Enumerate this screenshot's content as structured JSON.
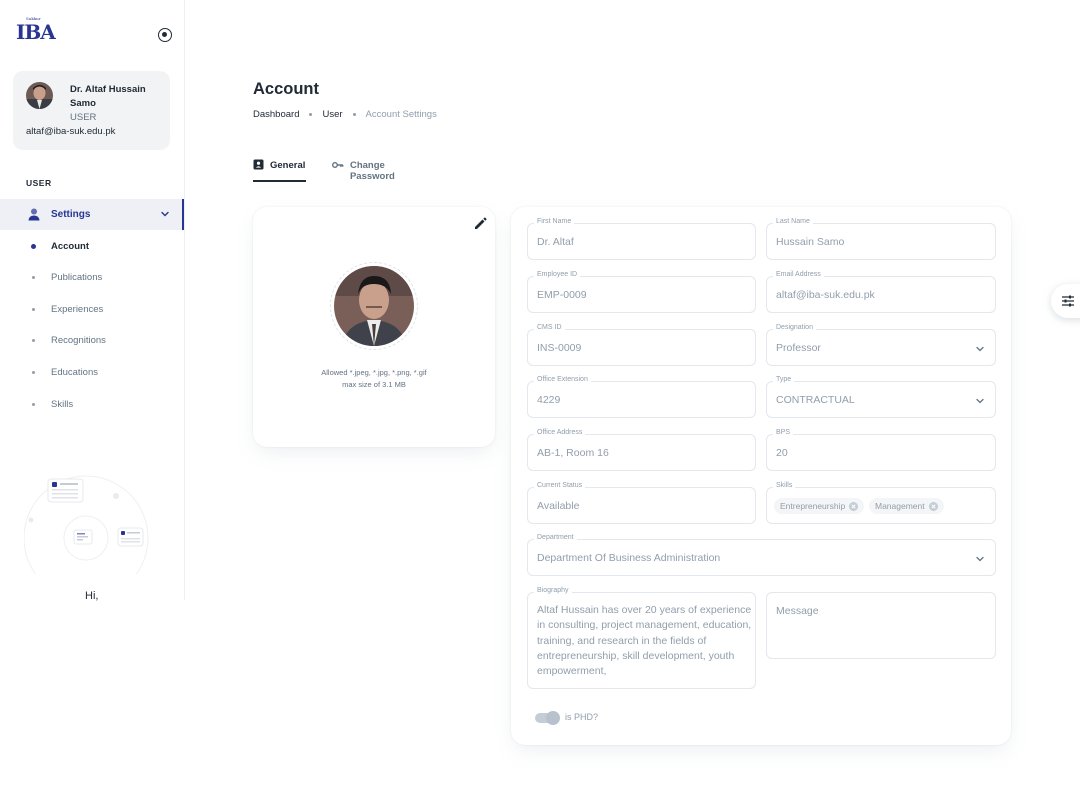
{
  "sidebar": {
    "logo": {
      "small": "Sukkur",
      "big": "IBA"
    },
    "user": {
      "name": "Dr. Altaf Hussain Samo",
      "role": "USER",
      "email": "altaf@iba-suk.edu.pk"
    },
    "subheader": "USER",
    "settings_label": "Settings",
    "items": [
      {
        "label": "Account",
        "active": true
      },
      {
        "label": "Publications"
      },
      {
        "label": "Experiences"
      },
      {
        "label": "Recognitions"
      },
      {
        "label": "Educations"
      },
      {
        "label": "Skills"
      }
    ],
    "greeting": "Hi,"
  },
  "page": {
    "title": "Account",
    "breadcrumb": [
      "Dashboard",
      "User",
      "Account Settings"
    ]
  },
  "tabs": [
    {
      "label": "General",
      "icon": "id-card-icon",
      "active": true
    },
    {
      "label": "Change Password",
      "icon": "key-icon"
    }
  ],
  "avatar": {
    "help_line1": "Allowed *.jpeg, *.jpg, *.png, *.gif",
    "help_line2": "max size of 3.1 MB"
  },
  "form": {
    "first_name": {
      "label": "First Name",
      "value": "Dr. Altaf"
    },
    "last_name": {
      "label": "Last Name",
      "value": "Hussain Samo"
    },
    "employee_id": {
      "label": "Employee ID",
      "value": "EMP-0009"
    },
    "email": {
      "label": "Email Address",
      "value": "altaf@iba-suk.edu.pk"
    },
    "cms_id": {
      "label": "CMS ID",
      "value": "INS-0009"
    },
    "designation": {
      "label": "Designation",
      "value": "Professor"
    },
    "office_extension": {
      "label": "Office Extension",
      "value": "4229"
    },
    "type": {
      "label": "Type",
      "value": "CONTRACTUAL"
    },
    "office_address": {
      "label": "Office Address",
      "value": "AB-1, Room 16"
    },
    "bps": {
      "label": "BPS",
      "value": "20"
    },
    "current_status": {
      "label": "Current Status",
      "value": "Available"
    },
    "skills": {
      "label": "Skills",
      "chips": [
        "Entrepreneurship",
        "Management"
      ]
    },
    "department": {
      "label": "Department",
      "value": "Department Of Business Administration"
    },
    "biography": {
      "label": "Biography",
      "value": "Altaf Hussain has over 20 years of experience in consulting, project management, education, training, and research in the fields of entrepreneurship, skill development, youth empowerment,"
    },
    "message": {
      "placeholder": "Message"
    },
    "is_phd": {
      "label": "is PHD?",
      "checked": false
    }
  },
  "colors": {
    "primary": "#283593",
    "text": "#212b36",
    "muted": "#919eab",
    "border": "#e4e7eb"
  }
}
